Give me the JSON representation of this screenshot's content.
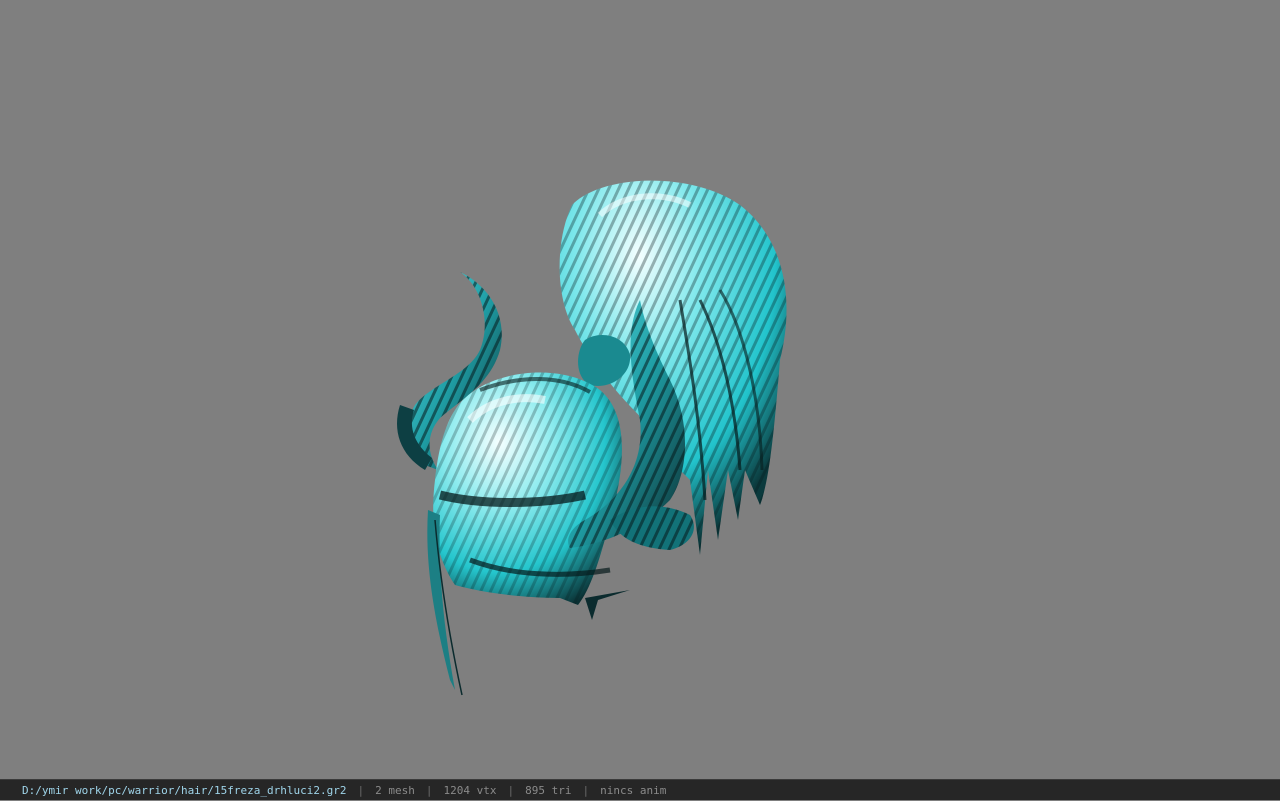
{
  "viewer": {
    "background_color": "#7f7f7f",
    "model_colors": {
      "primary": "#2fd0d8",
      "highlight": "#e8fbfb",
      "shadow": "#0a2426"
    }
  },
  "status_bar": {
    "file_path": "D:/ymir work/pc/warrior/hair/15freza_drhluci2.gr2",
    "separator": "|",
    "mesh_count": "2 mesh",
    "vertex_count": "1204 vtx",
    "triangle_count": "895 tri",
    "anim_status": "nincs anim"
  }
}
